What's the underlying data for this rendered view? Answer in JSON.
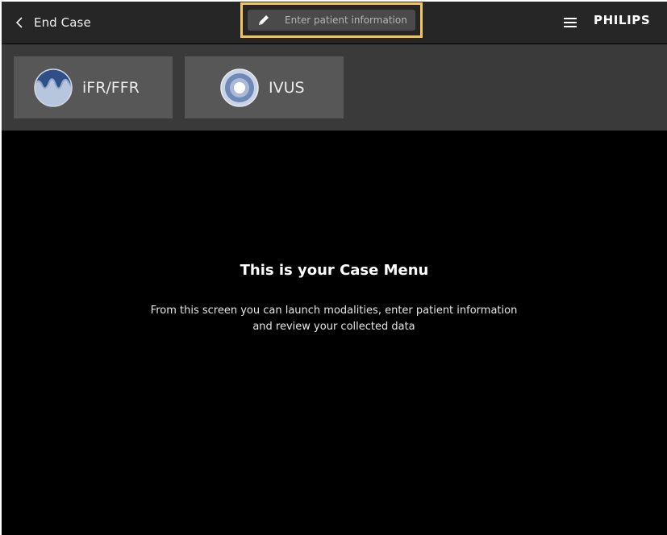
{
  "header": {
    "back_label": "End Case",
    "patient_button_label": "Enter patient information",
    "brand": "PHILIPS",
    "colors": {
      "bar": "#262626",
      "highlight": "#f3c55d"
    }
  },
  "modalities": [
    {
      "label": "iFR/FFR",
      "icon": "pressure-wave-icon"
    },
    {
      "label": "IVUS",
      "icon": "ivus-target-icon"
    }
  ],
  "main": {
    "title": "This is your Case Menu",
    "description_lines": [
      "From this screen you can launch modalities, enter patient information",
      "and review your collected data"
    ]
  }
}
